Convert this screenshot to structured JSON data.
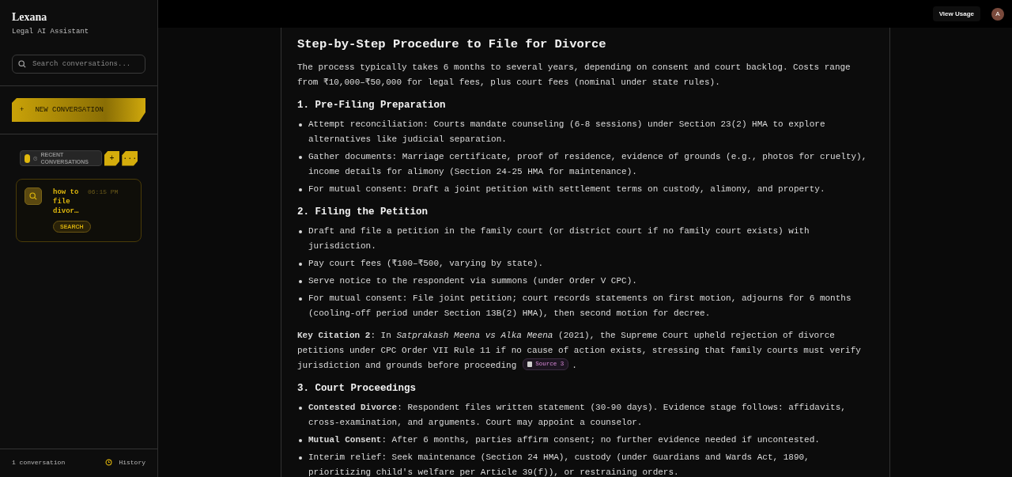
{
  "sidebar": {
    "logo": "Lexana",
    "tagline": "Legal AI Assistant",
    "search": {
      "placeholder": "Search conversations..."
    },
    "new_button": {
      "icon": "+",
      "label": "NEW CONVERSATION"
    },
    "recent": {
      "toggle_on": true,
      "label": "RECENT CONVERSATIONS",
      "add": "+",
      "more": "···"
    },
    "conversations": [
      {
        "title": "how to file divor…",
        "time": "06:15 PM",
        "tag": "SEARCH",
        "selected": true
      }
    ],
    "footer": {
      "count": "1 conversation",
      "history": "History"
    }
  },
  "topbar": {
    "usage": "View Usage",
    "avatar": "A"
  },
  "content": [
    {
      "kind": "title",
      "text": "Step-by-Step Procedure to File for Divorce"
    },
    {
      "kind": "paragraph",
      "text": "The process typically takes 6 months to several years, depending on consent and court backlog. Costs range from ₹10,000–₹50,000 for legal fees, plus court fees (nominal under state rules)."
    },
    {
      "kind": "heading",
      "text": "1. Pre-Filing Preparation"
    },
    {
      "kind": "list",
      "items": [
        "Attempt reconciliation: Courts mandate counseling (6-8 sessions) under Section 23(2) HMA to explore alternatives like judicial separation.",
        "Gather documents: Marriage certificate, proof of residence, evidence of grounds (e.g., photos for cruelty), income details for alimony (Section 24-25 HMA for maintenance).",
        "For mutual consent: Draft a joint petition with settlement terms on custody, alimony, and property."
      ]
    },
    {
      "kind": "heading",
      "text": "2. Filing the Petition"
    },
    {
      "kind": "list",
      "items": [
        "Draft and file a petition in the family court (or district court if no family court exists) with jurisdiction.",
        "Pay court fees (₹100–₹500, varying by state).",
        "Serve notice to the respondent via summons (under Order V CPC).",
        "For mutual consent: File joint petition; court records statements on first motion, adjourns for 6 months (cooling-off period under Section 13B(2) HMA), then second motion for decree."
      ]
    },
    {
      "kind": "paragraph",
      "text": "**Key Citation 2**: In *Satprakash Meena vs Alka Meena* (2021), the Supreme Court upheld rejection of divorce petitions under CPC Order VII Rule 11 if no cause of action exists, stressing that family courts must verify jurisdiction and grounds before proceeding",
      "source": "Source 3",
      "after": "."
    },
    {
      "kind": "heading",
      "text": "3. Court Proceedings"
    },
    {
      "kind": "list",
      "items": [
        "**Contested Divorce**: Respondent files written statement (30-90 days). Evidence stage follows: affidavits, cross-examination, and arguments. Court may appoint a counselor.",
        "**Mutual Consent**: After 6 months, parties affirm consent; no further evidence needed if uncontested.",
        "Interim relief: Seek maintenance (Section 24 HMA), custody (under Guardians and Wards Act, 1890, prioritizing child's welfare per Article 39(f)), or restraining orders."
      ]
    }
  ]
}
